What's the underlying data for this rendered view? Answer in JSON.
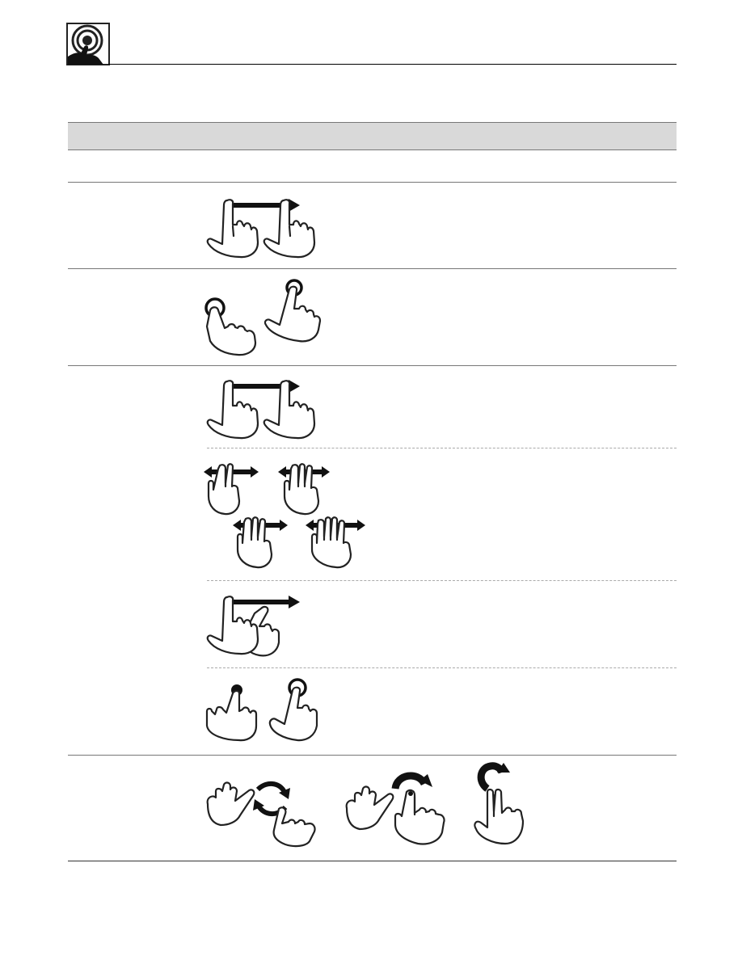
{
  "header": {
    "logo_icon": "touch-target-hand-icon",
    "rule_color": "#000000"
  },
  "table": {
    "header_fill": "#d9d9d9",
    "rows": [
      {
        "name": "row-1",
        "gestures": []
      },
      {
        "name": "row-2",
        "gestures": [
          "one-finger-swipe-right-icon"
        ]
      },
      {
        "name": "row-3",
        "gestures": [
          "one-finger-tap-left-icon",
          "one-finger-tap-top-icon"
        ]
      },
      {
        "name": "row-4",
        "gestures": [
          "one-finger-swipe-right-icon",
          "multi-finger-swipe-left-right-icon",
          "two-hand-swipe-right-icon",
          "tap-and-hold-icon"
        ]
      },
      {
        "name": "row-5",
        "gestures": [
          "two-hand-rotate-icon",
          "rotate-around-finger-icon",
          "two-finger-rotate-icon"
        ]
      }
    ]
  }
}
